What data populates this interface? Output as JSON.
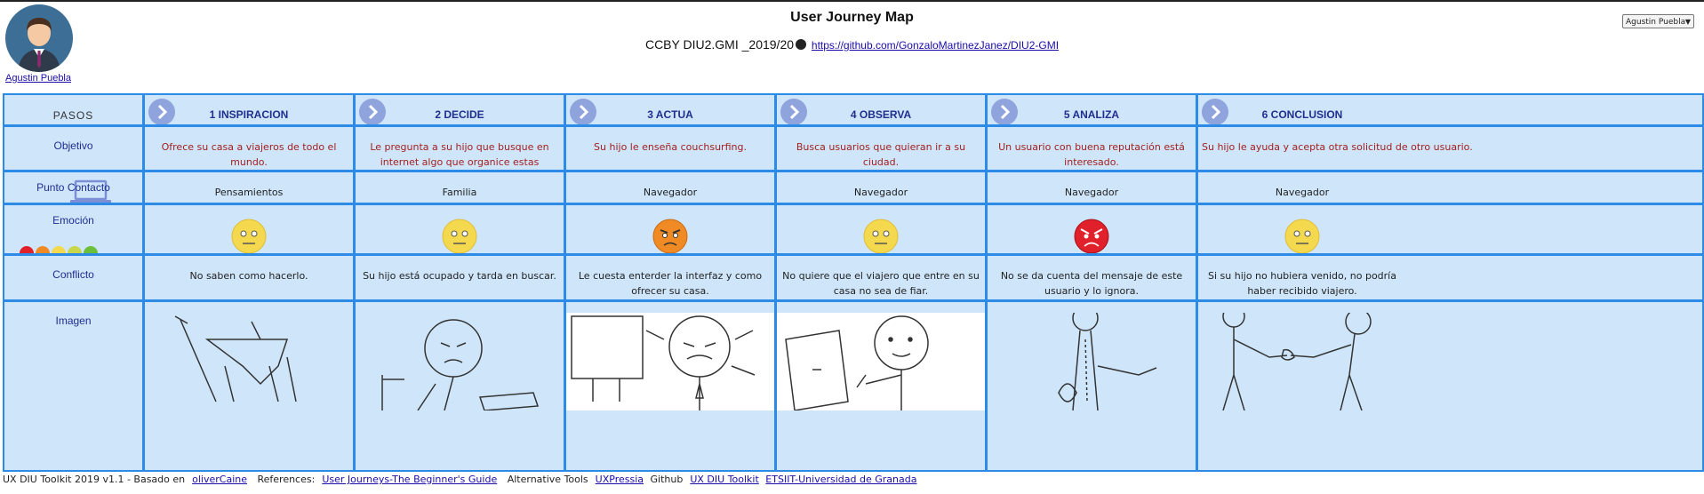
{
  "header": {
    "title": "User Journey Map",
    "license_prefix": "CCBY",
    "license_text": "DIU2.GMI _2019/20",
    "repo_link": "https://github.com/GonzaloMartinezJanez/DIU2-GMI",
    "user_name": "Agustin Puebla",
    "user_select_value": "Agustin Puebla"
  },
  "rows": {
    "steps_label": "PASOS",
    "goal_label": "Objetivo",
    "touch_label": "Punto Contacto",
    "emotion_label": "Emoción",
    "conflict_label": "Conflicto",
    "image_label": "Imagen"
  },
  "steps": [
    {
      "title": "1 INSPIRACION",
      "goal": "Ofrece su casa a viajeros de todo el mundo.",
      "touchpoint": "Pensamientos",
      "emotion": "neutral",
      "conflict": "No saben como hacerlo."
    },
    {
      "title": "2 DECIDE",
      "goal": "Le pregunta a su hijo que busque en internet algo que organice estas actividades.",
      "touchpoint": "Familia",
      "emotion": "neutral",
      "conflict": "Su hijo está ocupado y tarda en buscar."
    },
    {
      "title": "3 ACTUA",
      "goal": "Su hijo le enseña couchsurfing.",
      "touchpoint": "Navegador",
      "emotion": "annoyed",
      "conflict": "Le cuesta enterder la interfaz y como ofrecer su casa."
    },
    {
      "title": "4 OBSERVA",
      "goal": "Busca usuarios que quieran ir a su ciudad.",
      "touchpoint": "Navegador",
      "emotion": "neutral",
      "conflict": "No quiere que el viajero que entre en su casa no sea de fiar."
    },
    {
      "title": "5 ANALIZA",
      "goal": "Un usuario con buena reputación está interesado.",
      "touchpoint": "Navegador",
      "emotion": "angry",
      "conflict": "No se da cuenta del mensaje de este usuario y lo ignora."
    },
    {
      "title": "6 CONCLUSION",
      "goal": "Su hijo le ayuda y acepta otra solicitud de otro usuario.",
      "touchpoint": "Navegador",
      "emotion": "neutral",
      "conflict": "Si su hijo no hubiera venido, no podría haber recibido viajero."
    }
  ],
  "emotion_colors": {
    "angry": "#e0202a",
    "annoyed": "#f08a24",
    "neutral": "#f4d84e",
    "content": "#b8d64a",
    "happy": "#6cbf3a"
  },
  "icons": [
    "chevron-right-icon",
    "laptop-icon",
    "github-icon",
    "avatar"
  ],
  "footer": {
    "toolkit_text": "UX DIU Toolkit 2019 v1.1 - Basado en",
    "based_link": "oliverCaine",
    "refs_label": "References:",
    "refs_link": "User Journeys-The Beginner's Guide",
    "alt_label": "Alternative Tools",
    "alt_link": "UXPressia",
    "github_label": "Github",
    "github_link": "UX DIU Toolkit",
    "org_link": "ETSIIT-Universidad de Granada"
  }
}
